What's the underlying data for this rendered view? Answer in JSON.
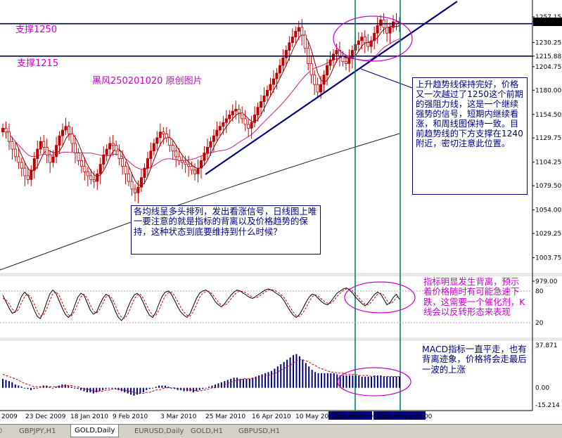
{
  "colors": {
    "candle": "#c00000",
    "ma_fast": "#8b0000",
    "ma_mid": "#cc2288",
    "ma_slow": "#222222",
    "trendline": "#000080",
    "support": "#000050",
    "vertical": "#00806a",
    "osc_main": "#000000",
    "osc_signal": "#cc0000",
    "macd_hist": "#000080",
    "macd_signal": "#cc0000",
    "text_blue": "#000080",
    "text_magenta": "#cc00cc"
  },
  "annotations": {
    "support_1250": "支撑1250",
    "support_1215": "支撑1215",
    "watermark": "黑风250201020  原创图片",
    "right_note": "上升趋势线保持完好，价格又一次越过了1250这个前期的强阻力线，这是一个继续强势的信号，短期内继续看涨，和周线图保持一致。目前趋势线的下方支撑在1240附近，密切注意此位置。",
    "left_note": "各均线呈多头排列，发出看涨信号，日线图上唯一要注意的就是指标的背离以及价格趋势的保持，这种状态到底要维持到什么时候？",
    "osc_note": "指标明显发生背离，预示着价格随时有可能急速下跌，这需要一个催化剂，K线会以反转形态来表现",
    "macd_note": "MACD指标一直平走，也有背离迹象，价格将会走最后一波的上涨"
  },
  "tabs": [
    "GBPJPY,H1",
    "GOLD,Daily",
    "EURUSD,Daily",
    "GOLD,H1",
    "GBPUSD,H1"
  ],
  "active_tab": "GOLD,Daily",
  "chart_data": [
    {
      "type": "candlestick",
      "symbol": "GOLD,Daily",
      "y_ticks": [
        "1257.15",
        "1251.96",
        "1230.25",
        "1215.88",
        "1204.75",
        "1180.00",
        "1154.50",
        "1129.75",
        "1104.25",
        "1079.50",
        "1054.00",
        "1029.25",
        "1003.75",
        "979.00"
      ],
      "ylim": [
        979.0,
        1257.15
      ],
      "x_ticks": [
        "2009",
        "23 Dec 2009",
        "18 Jan 2010",
        "9 Feb 2010",
        "3 Mar 2010",
        "25 Mar 2010",
        "16 Apr 2010",
        "10 May 20",
        "2010.06.07 00",
        "2010.06.28 00:00"
      ],
      "current_price": 1251.96,
      "support_levels": [
        1250,
        1215.88
      ],
      "close": [
        1140,
        1136,
        1126,
        1118,
        1110,
        1104,
        1098,
        1090,
        1086,
        1096,
        1108,
        1118,
        1126,
        1120,
        1112,
        1104,
        1110,
        1122,
        1132,
        1138,
        1142,
        1134,
        1124,
        1114,
        1106,
        1100,
        1094,
        1090,
        1086,
        1084,
        1092,
        1102,
        1112,
        1118,
        1124,
        1122,
        1116,
        1108,
        1100,
        1092,
        1084,
        1076,
        1072,
        1078,
        1088,
        1098,
        1108,
        1116,
        1124,
        1130,
        1136,
        1134,
        1130,
        1122,
        1116,
        1110,
        1106,
        1104,
        1102,
        1100,
        1096,
        1092,
        1098,
        1106,
        1114,
        1120,
        1126,
        1132,
        1138,
        1142,
        1146,
        1150,
        1154,
        1158,
        1160,
        1156,
        1150,
        1144,
        1140,
        1146,
        1154,
        1162,
        1168,
        1174,
        1180,
        1186,
        1192,
        1198,
        1206,
        1214,
        1222,
        1230,
        1236,
        1242,
        1246,
        1238,
        1224,
        1208,
        1196,
        1186,
        1178,
        1186,
        1196,
        1206,
        1212,
        1218,
        1222,
        1216,
        1210,
        1208,
        1214,
        1222,
        1228,
        1232,
        1236,
        1230,
        1226,
        1232,
        1240,
        1248,
        1254,
        1246,
        1240,
        1246,
        1252,
        1250,
        1252
      ]
    },
    {
      "type": "line",
      "name": "stochastic",
      "y_ticks": [
        "80",
        "20"
      ],
      "ylim": [
        0,
        100
      ],
      "main": [
        72,
        60,
        48,
        38,
        40,
        55,
        70,
        78,
        72,
        60,
        45,
        32,
        28,
        40,
        58,
        74,
        82,
        76,
        62,
        48,
        36,
        30,
        36,
        52,
        68,
        76,
        72,
        58,
        44,
        36,
        40,
        54,
        66,
        74,
        70,
        58,
        42,
        30,
        24,
        32,
        48,
        62,
        72,
        76,
        70,
        58,
        44,
        34,
        30,
        40,
        56,
        70,
        78,
        80,
        74,
        62,
        50,
        40,
        34,
        30,
        38,
        52,
        66,
        76,
        80,
        82,
        78,
        70,
        60,
        54,
        50,
        56,
        64,
        72,
        78,
        82,
        80,
        76,
        72,
        68,
        66,
        70,
        74,
        78,
        82,
        84,
        82,
        78,
        74,
        70,
        62,
        52,
        42,
        34,
        30,
        36,
        46,
        58,
        68,
        74,
        72,
        66,
        60,
        56,
        54,
        60,
        68,
        76,
        80,
        84,
        86,
        82,
        76,
        68,
        62,
        56,
        52,
        58,
        66,
        74,
        78,
        74,
        64,
        54,
        58,
        68,
        74,
        64
      ],
      "signal": [
        66,
        64,
        56,
        46,
        40,
        45,
        58,
        70,
        74,
        68,
        56,
        42,
        33,
        34,
        46,
        62,
        75,
        79,
        72,
        58,
        45,
        35,
        33,
        42,
        56,
        69,
        74,
        67,
        54,
        42,
        38,
        45,
        57,
        69,
        72,
        66,
        53,
        39,
        30,
        28,
        36,
        50,
        64,
        73,
        74,
        66,
        54,
        42,
        34,
        34,
        44,
        59,
        71,
        77,
        78,
        71,
        60,
        49,
        40,
        34,
        33,
        41,
        54,
        68,
        76,
        79,
        79,
        75,
        67,
        59,
        53,
        53,
        57,
        65,
        72,
        78,
        80,
        79,
        76,
        72,
        68,
        67,
        70,
        74,
        78,
        82,
        83,
        81,
        78,
        74,
        68,
        59,
        49,
        40,
        33,
        32,
        38,
        48,
        59,
        69,
        73,
        70,
        65,
        60,
        57,
        57,
        62,
        70,
        76,
        81,
        84,
        84,
        80,
        74,
        67,
        60,
        55,
        54,
        59,
        67,
        74,
        76,
        72,
        62,
        56,
        60,
        68,
        70
      ]
    },
    {
      "type": "bar",
      "name": "MACD",
      "y_ticks": [
        "37.871",
        "0.00",
        "-15.214"
      ],
      "ylim": [
        -15.214,
        37.871
      ],
      "histogram": [
        8,
        7,
        6,
        5,
        3,
        2,
        1,
        0,
        -1,
        -2,
        -1,
        0,
        1,
        2,
        2,
        1,
        0,
        1,
        2,
        3,
        3,
        2,
        1,
        0,
        -1,
        -2,
        -3,
        -4,
        -4,
        -5,
        -4,
        -3,
        -2,
        -1,
        0,
        0,
        -1,
        -2,
        -3,
        -4,
        -5,
        -6,
        -7,
        -6,
        -5,
        -4,
        -2,
        -1,
        0,
        1,
        2,
        2,
        2,
        1,
        0,
        -1,
        -2,
        -2,
        -3,
        -3,
        -3,
        -4,
        -3,
        -2,
        -1,
        0,
        1,
        2,
        3,
        4,
        5,
        6,
        7,
        8,
        9,
        9,
        8,
        8,
        8,
        8,
        9,
        10,
        11,
        12,
        13,
        14,
        15,
        17,
        19,
        21,
        23,
        25,
        27,
        29,
        30,
        28,
        25,
        22,
        19,
        16,
        14,
        13,
        13,
        13,
        13,
        13,
        13,
        12,
        11,
        11,
        11,
        11,
        11,
        11,
        11,
        10,
        10,
        10,
        10,
        11,
        11,
        11,
        10,
        10,
        10,
        10,
        10,
        10
      ],
      "signal": [
        12,
        11,
        10,
        9,
        8,
        7,
        5,
        4,
        3,
        2,
        1,
        1,
        1,
        1,
        1,
        1,
        1,
        1,
        1,
        1,
        2,
        2,
        2,
        1,
        1,
        0,
        -1,
        -1,
        -2,
        -3,
        -3,
        -3,
        -3,
        -2,
        -2,
        -1,
        -1,
        -1,
        -2,
        -2,
        -3,
        -3,
        -4,
        -5,
        -5,
        -5,
        -4,
        -4,
        -3,
        -2,
        -2,
        -1,
        0,
        0,
        0,
        0,
        -1,
        -1,
        -1,
        -2,
        -2,
        -2,
        -3,
        -3,
        -2,
        -2,
        -1,
        0,
        0,
        1,
        2,
        3,
        4,
        5,
        6,
        7,
        7,
        8,
        8,
        8,
        8,
        9,
        9,
        10,
        11,
        11,
        12,
        13,
        14,
        16,
        17,
        19,
        20,
        22,
        24,
        25,
        25,
        24,
        23,
        21,
        20,
        18,
        17,
        16,
        15,
        14,
        14,
        13,
        13,
        13,
        12,
        12,
        12,
        12,
        11,
        11,
        11,
        11,
        10,
        10,
        10,
        10,
        10,
        10,
        10,
        10,
        10,
        10
      ]
    }
  ]
}
